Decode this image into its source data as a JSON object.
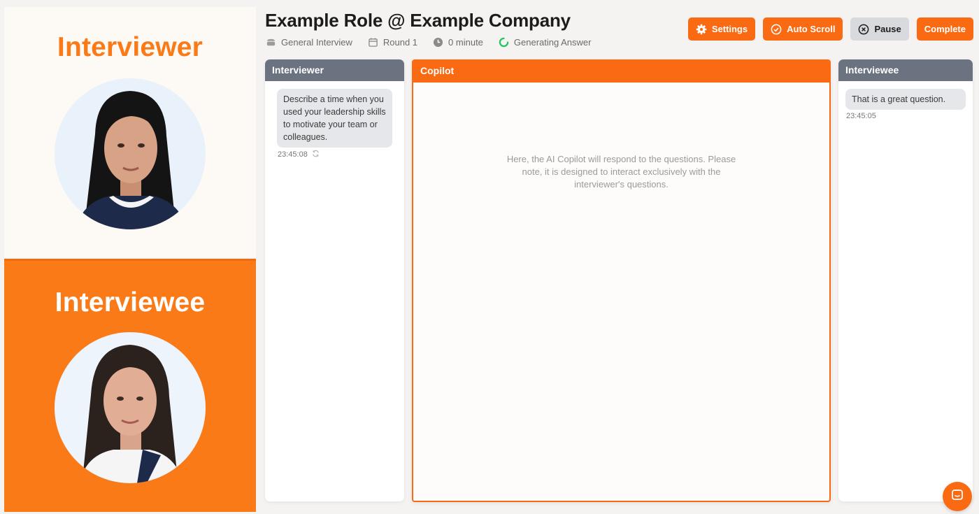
{
  "left": {
    "interviewer_title": "Interviewer",
    "interviewee_title": "Interviewee"
  },
  "header": {
    "title": "Example Role @ Example Company",
    "meta": {
      "interview_type": "General Interview",
      "round": "Round 1",
      "duration": "0 minute",
      "status": "Generating Answer"
    }
  },
  "toolbar": {
    "settings_label": "Settings",
    "auto_scroll_label": "Auto Scroll",
    "pause_label": "Pause",
    "complete_label": "Complete"
  },
  "panels": {
    "interviewer": {
      "title": "Interviewer",
      "messages": [
        {
          "text": "Describe a time when you used your leadership skills to motivate your team or colleagues.",
          "time": "23:45:08"
        }
      ]
    },
    "copilot": {
      "title": "Copilot",
      "placeholder": "Here, the AI Copilot will respond to the questions. Please note, it is designed to interact exclusively with the interviewer's questions."
    },
    "interviewee": {
      "title": "Interviewee",
      "messages": [
        {
          "text": "That is a great question.",
          "time": "23:45:05"
        }
      ]
    }
  },
  "colors": {
    "accent": "#f96a12",
    "panel_header_gray": "#6b7280",
    "status_spinner": "#22c55e"
  },
  "icons": [
    "briefcase-icon",
    "calendar-icon",
    "clock-icon",
    "spinner-icon",
    "gear-icon",
    "check-circle-icon",
    "close-circle-icon",
    "refresh-icon",
    "chat-icon"
  ]
}
